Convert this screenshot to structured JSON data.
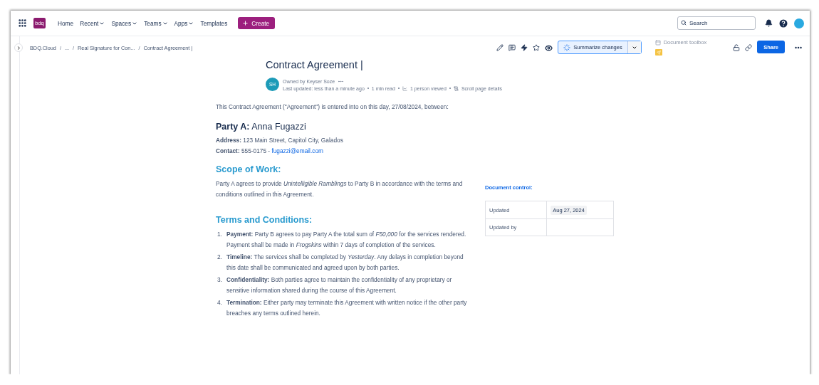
{
  "nav": {
    "logo": "bdq",
    "items": [
      {
        "label": "Home",
        "dropdown": false
      },
      {
        "label": "Recent",
        "dropdown": true
      },
      {
        "label": "Spaces",
        "dropdown": true
      },
      {
        "label": "Teams",
        "dropdown": true
      },
      {
        "label": "Apps",
        "dropdown": true
      },
      {
        "label": "Templates",
        "dropdown": false
      }
    ],
    "create": "Create",
    "search": {
      "placeholder": "Search"
    }
  },
  "breadcrumbs": {
    "separator": "/",
    "items": [
      "BDQ.Cloud",
      "...",
      "Real Signature for Con...",
      "Contract Agreement |"
    ]
  },
  "toolbar": {
    "summarize": "Summarize changes",
    "document_toolbox": "Document toolbox",
    "share": "Share"
  },
  "page": {
    "title": "Contract Agreement |",
    "avatar": "SH",
    "owner": "Owned by Keyser Soze",
    "meta": [
      "Last updated: less than a minute ago",
      "1 min read",
      "1 person viewed",
      "Scroll page details"
    ],
    "intro": "This Contract Agreement (\"Agreement\") is entered into on this day, 27/08/2024, between:",
    "party": {
      "heading": "**Party A:** Anna Fugazzi",
      "address": "**Address:** 123 Main Street, Capitol City, Galados",
      "contact": "**Contact:** 555-0175 - ",
      "email": "fugazzi@email.com"
    },
    "scope": {
      "heading": "Scope of Work:",
      "text": "Party A agrees to provide *Unintelligible Ramblings* to Party B in accordance with the terms and conditions outlined in this Agreement."
    },
    "terms": {
      "heading": "Terms and Conditions:",
      "items": [
        {
          "number": "1.",
          "text": "**Payment:** Party B agrees to pay Party A the total sum of *F50,000* for the services rendered. Payment shall be made in *Frogskins* within 7 days of completion of the services."
        },
        {
          "number": "2.",
          "text": "**Timeline:** The services shall be completed by *Yesterday*. Any delays in completion beyond this date shall be communicated and agreed upon by both parties."
        },
        {
          "number": "3.",
          "text": "**Confidentiality:** Both parties agree to maintain the confidentiality of any proprietary or sensitive information shared during the course of this Agreement."
        },
        {
          "number": "4.",
          "text": "**Termination:** Either party may terminate this Agreement with written notice if the other party breaches any terms outlined herein."
        }
      ]
    }
  },
  "document_control": {
    "title": "Document control:",
    "rows": [
      {
        "label": "Updated",
        "value": "Aug 27, 2024"
      },
      {
        "label": "Updated by"
      }
    ]
  }
}
